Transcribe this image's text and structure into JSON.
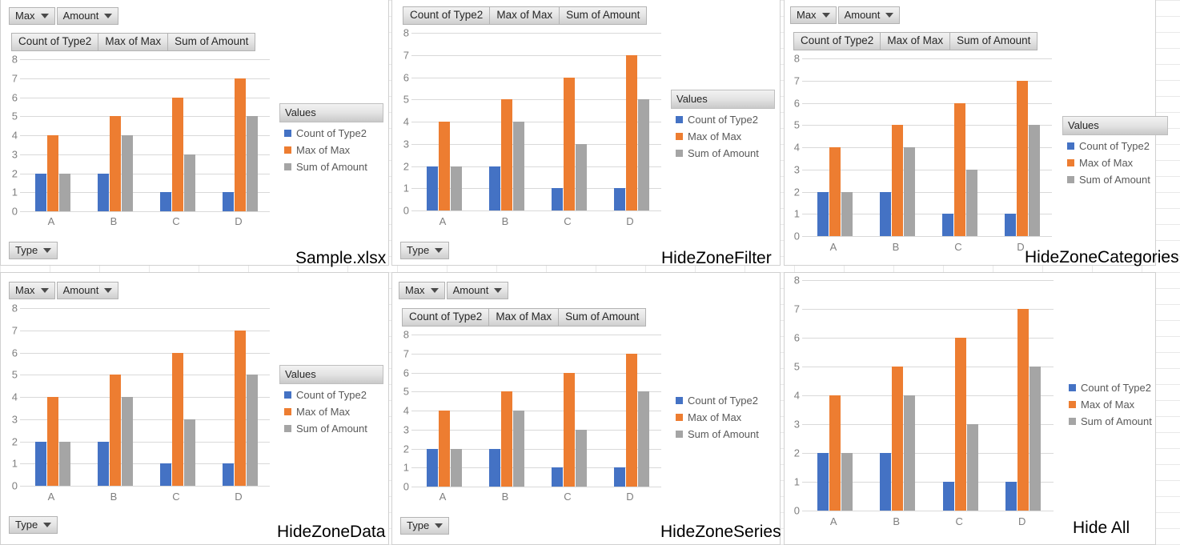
{
  "colors": {
    "series_blue": "#4472C4",
    "series_orange": "#ED7D31",
    "series_grey": "#A5A5A5",
    "gridline": "#D9D9D9",
    "axis_text": "#7F7F7F",
    "button_text": "#262626",
    "panel_border": "#D0D0D0"
  },
  "labels": {
    "filter_max": "Max",
    "filter_amount": "Amount",
    "value_count_type2": "Count  of Type2",
    "value_max_of_max": "Max of Max",
    "value_sum_of_amount": "Sum of Amount",
    "axis_type": "Type",
    "legend_title": "Values",
    "legend_count_type2": "Count of Type2",
    "legend_max_of_max": "Max of Max",
    "legend_sum_of_amount": "Sum of Amount"
  },
  "chart_data": {
    "type": "bar",
    "title": "",
    "xlabel": "",
    "ylabel": "",
    "ylim": [
      0,
      8
    ],
    "yticks": [
      0,
      1,
      2,
      3,
      4,
      5,
      6,
      7,
      8
    ],
    "grid": true,
    "legend_position": "right",
    "categories": [
      "A",
      "B",
      "C",
      "D"
    ],
    "series": [
      {
        "name": "Count of Type2",
        "color": "#4472C4",
        "values": [
          2,
          2,
          1,
          1
        ]
      },
      {
        "name": "Max of Max",
        "color": "#ED7D31",
        "values": [
          4,
          5,
          6,
          7
        ]
      },
      {
        "name": "Sum of Amount",
        "color": "#A5A5A5",
        "values": [
          2,
          4,
          3,
          5
        ]
      }
    ]
  },
  "panels": [
    {
      "id": "sample",
      "caption": "Sample.xlsx",
      "show_report_filters": true,
      "show_value_buttons": true,
      "show_axis_button": true,
      "show_legend_title": true
    },
    {
      "id": "hidezonefilter",
      "caption": "HideZoneFilter",
      "show_report_filters": false,
      "show_value_buttons": true,
      "show_axis_button": true,
      "show_legend_title": true
    },
    {
      "id": "hidezonecategories",
      "caption": "HideZoneCategories",
      "show_report_filters": true,
      "show_value_buttons": true,
      "show_axis_button": false,
      "show_legend_title": true
    },
    {
      "id": "hidezonedata",
      "caption": "HideZoneData",
      "show_report_filters": true,
      "show_value_buttons": false,
      "show_axis_button": true,
      "show_legend_title": true
    },
    {
      "id": "hidezoneseries",
      "caption": "HideZoneSeries",
      "show_report_filters": true,
      "show_value_buttons": true,
      "show_axis_button": true,
      "show_legend_title": false
    },
    {
      "id": "hideall",
      "caption": "Hide All",
      "show_report_filters": false,
      "show_value_buttons": false,
      "show_axis_button": false,
      "show_legend_title": false
    }
  ]
}
